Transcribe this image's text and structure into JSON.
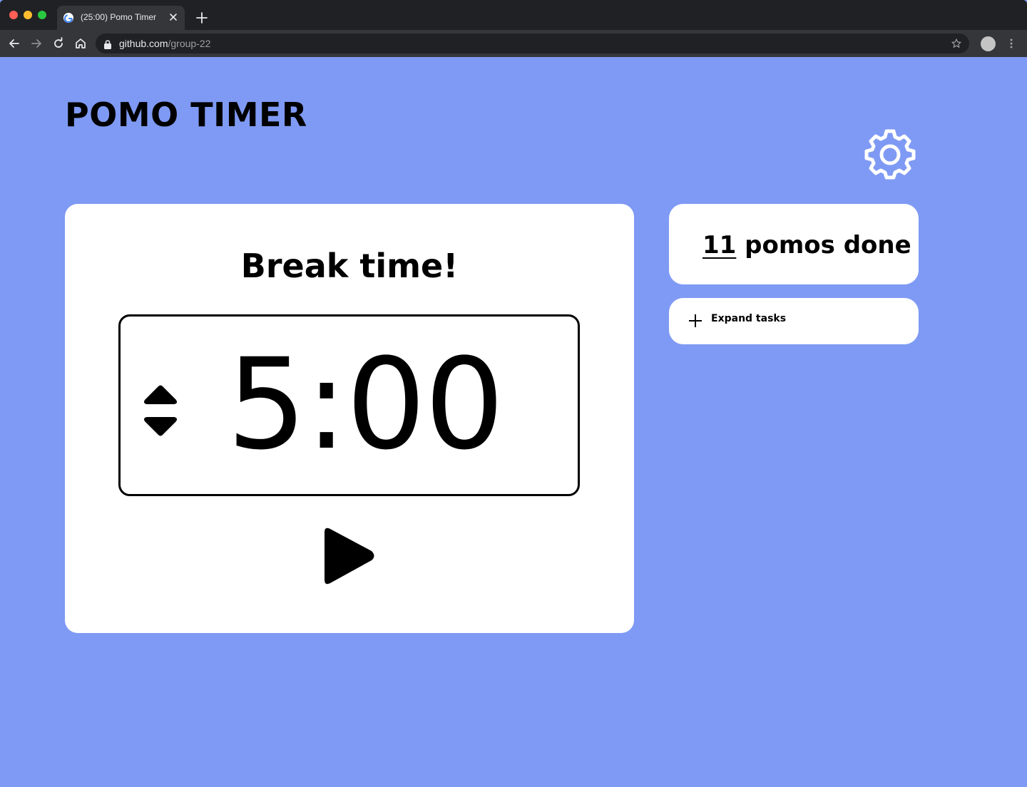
{
  "browser": {
    "tab_title": "(25:00) Pomo Timer",
    "url_host": "github.com",
    "url_path": "/group-22"
  },
  "app": {
    "title": "POMO TIMER",
    "mode_heading": "Break time!",
    "time": "5:00",
    "pomos_done_count": "11",
    "pomos_done_label": " pomos done",
    "expand_tasks_label": "Expand tasks"
  },
  "colors": {
    "background": "#7f9af4",
    "card": "#ffffff",
    "text": "#000000"
  },
  "icons": {
    "settings": "gear-icon",
    "adjust": "up-down-arrows-icon",
    "play": "play-icon",
    "expand": "plus-icon"
  }
}
